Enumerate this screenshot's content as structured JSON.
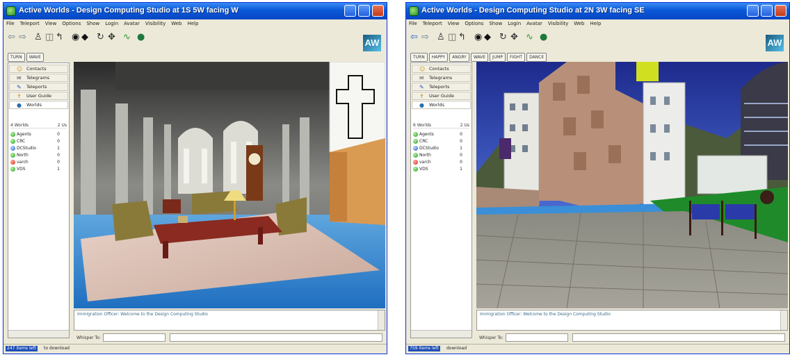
{
  "windows": [
    {
      "title": "Active Worlds - Design Computing Studio at 1S 5W facing W",
      "menu": [
        "File",
        "Teleport",
        "View",
        "Options",
        "Show",
        "Login",
        "Avatar",
        "Visibility",
        "Web",
        "Help"
      ],
      "gestures": [
        "TURN",
        "WAVE"
      ],
      "logo_text": "AW",
      "sidebar_buttons": [
        "Contacts",
        "Telegrams",
        "Teleports",
        "User Guide",
        "Worlds"
      ],
      "worlds_header": {
        "label": "4 Worlds",
        "count": "2 Us"
      },
      "worlds": [
        {
          "name": "Agents",
          "users": "0",
          "status": "green"
        },
        {
          "name": "CRC",
          "users": "0",
          "status": "green"
        },
        {
          "name": "DCStudio",
          "users": "1",
          "status": "blue"
        },
        {
          "name": "North",
          "users": "0",
          "status": "green"
        },
        {
          "name": "varch",
          "users": "0",
          "status": "red"
        },
        {
          "name": "VDS",
          "users": "1",
          "status": "green"
        }
      ],
      "chat": "Immigration Officer:     Welcome to the Design Computing Studio",
      "whisper_label": "Whisper To:",
      "status_progress": "247 items left",
      "status_rest": "to download"
    },
    {
      "title": "Active Worlds - Design Computing Studio at 2N 3W facing SE",
      "menu": [
        "File",
        "Teleport",
        "View",
        "Options",
        "Show",
        "Login",
        "Avatar",
        "Visibility",
        "Web",
        "Help"
      ],
      "gestures": [
        "TURN",
        "HAPPY",
        "ANGRY",
        "WAVE",
        "JUMP",
        "FIGHT",
        "DANCE"
      ],
      "logo_text": "AW",
      "sidebar_buttons": [
        "Contacts",
        "Telegrams",
        "Teleports",
        "User Guide",
        "Worlds"
      ],
      "worlds_header": {
        "label": "6 Worlds",
        "count": "2 Us"
      },
      "worlds": [
        {
          "name": "Agents",
          "users": "0",
          "status": "green"
        },
        {
          "name": "CRC",
          "users": "0",
          "status": "green"
        },
        {
          "name": "DCStudio",
          "users": "1",
          "status": "blue"
        },
        {
          "name": "North",
          "users": "0",
          "status": "green"
        },
        {
          "name": "varch",
          "users": "0",
          "status": "red"
        },
        {
          "name": "VDS",
          "users": "1",
          "status": "green"
        }
      ],
      "chat": "Immigration Officer:     Welcome to the Design Computing Studio",
      "whisper_label": "Whisper To:",
      "status_progress": "759 items left",
      "status_rest": "download"
    }
  ],
  "icons": {
    "toolbar": [
      "back-arrow-icon",
      "forward-arrow-icon",
      "walk-icon",
      "camera-icon",
      "cursor-icon",
      "binoculars-icon",
      "pointer-icon",
      "select-icon",
      "snake-icon",
      "globe-icon"
    ],
    "sidebar": [
      "contacts-icon",
      "telegrams-icon",
      "teleports-icon",
      "user-guide-icon",
      "worlds-icon"
    ]
  }
}
